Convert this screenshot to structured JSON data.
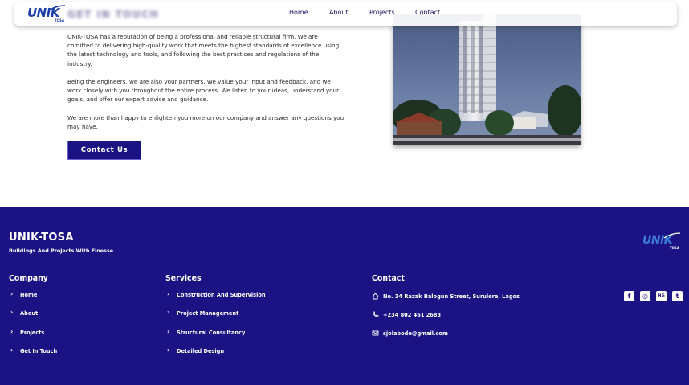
{
  "header": {
    "logo_text": "UNIK",
    "logo_sub": "TOSA",
    "ghost_title": "GET IN TOUCH",
    "nav": [
      "Home",
      "About",
      "Projects",
      "Contact"
    ]
  },
  "about": {
    "paragraphs": [
      "UNIK-TOSA has a reputation of being a professional and reliable structural firm. We are comitted to delivering high-quality work that meets the highest standards of excellence using the latest technology and tools, and following the best practices and regulations of the industry.",
      "Being the engineers, we are also your partners. We value your input and feedback, and we work closely with you throughout the entire process. We listen to your ideas, understand your goals, and offer our expert advice and guidance.",
      "We are more than happy to enlighten you more on our company and answer any questions you may have."
    ],
    "cta_label": "Contact Us"
  },
  "footer": {
    "brand": "UNIK-TOSA",
    "tagline": "Buildings And Projects With Finesse",
    "logo_text": "UNIK",
    "logo_sub": "TOSA",
    "company": {
      "heading": "Company",
      "items": [
        "Home",
        "About",
        "Projects",
        "Get In Touch"
      ]
    },
    "services": {
      "heading": "Services",
      "items": [
        "Construction And Supervision",
        "Project Management",
        "Structural Consultancy",
        "Detailed Design"
      ]
    },
    "contact": {
      "heading": "Contact",
      "address": "No. 34 Razak Balogun Street, Surulere, Lagos",
      "phone": "+234 802 461 2683",
      "email": "sjolabode@gmail.com"
    },
    "socials": [
      {
        "icon": "facebook-icon",
        "glyph": "f"
      },
      {
        "icon": "instagram-icon",
        "glyph": "◎"
      },
      {
        "icon": "behance-icon",
        "glyph": "Bē"
      },
      {
        "icon": "twitter-icon",
        "glyph": "t"
      }
    ]
  },
  "colors": {
    "primary": "#1b1283",
    "logo_blue": "#1d3fa8",
    "text": "#2a2a2a"
  }
}
